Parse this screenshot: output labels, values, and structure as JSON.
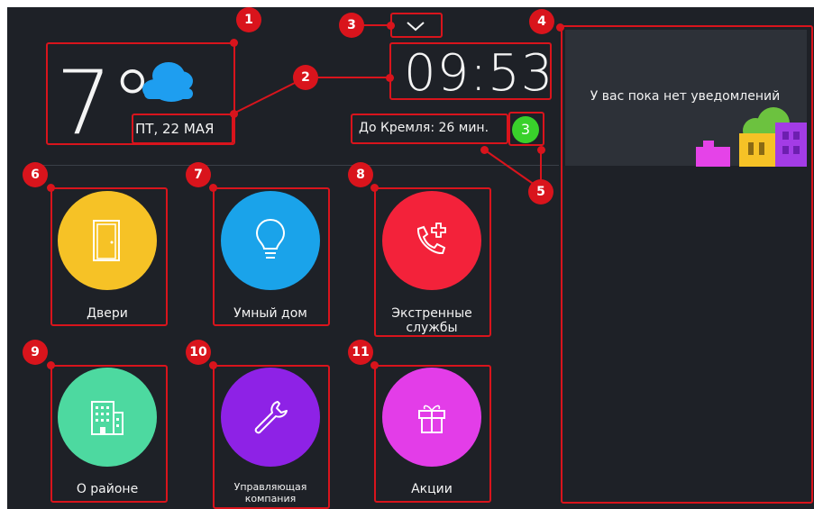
{
  "weather": {
    "temperature": "7°",
    "date": "ПТ, 22 МАЯ",
    "icon": "cloud-icon"
  },
  "clock": {
    "time": "09:53"
  },
  "travel": {
    "text": "До Кремля: 26 мин.",
    "score": "3"
  },
  "notifications": {
    "empty_text": "У вас пока нет уведомлений"
  },
  "tiles": [
    {
      "label": "Двери",
      "color": "#f6c226",
      "icon": "door-icon"
    },
    {
      "label": "Умный дом",
      "color": "#1aa3ea",
      "icon": "lightbulb-icon"
    },
    {
      "label_line1": "Экстренные",
      "label_line2": "службы",
      "color": "#f3223a",
      "icon": "emergency-phone-icon"
    },
    {
      "label": "О районе",
      "color": "#4dd9a0",
      "icon": "building-icon"
    },
    {
      "label_line1": "Управляющая",
      "label_line2": "компания",
      "color": "#8e22e6",
      "icon": "wrench-icon"
    },
    {
      "label": "Акции",
      "color": "#e33de8",
      "icon": "gift-icon"
    }
  ],
  "callouts": [
    "1",
    "2",
    "3",
    "4",
    "5",
    "6",
    "7",
    "8",
    "9",
    "10",
    "11"
  ],
  "colors": {
    "background": "#1e2127",
    "callout": "#d9141c"
  }
}
